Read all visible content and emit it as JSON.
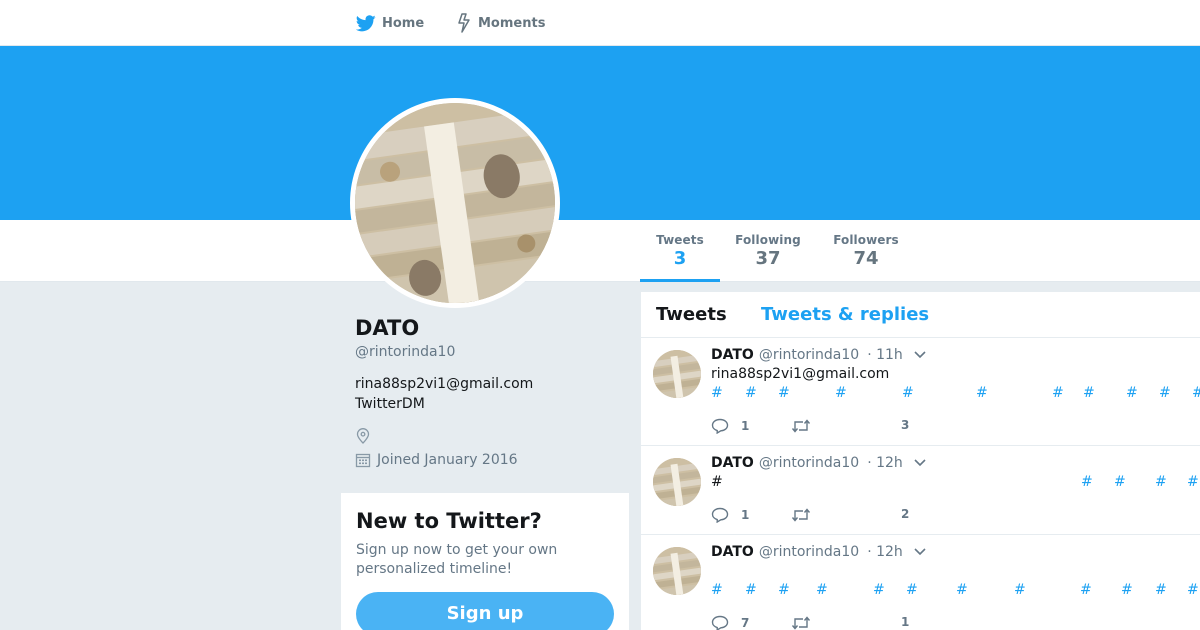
{
  "nav": {
    "home": "Home",
    "moments": "Moments"
  },
  "colors": {
    "brand": "#1da1f2",
    "banner": "#1da1f2",
    "background": "#e6ecf0",
    "signup_button": "#4ab3f4"
  },
  "stats": {
    "tweets_label": "Tweets",
    "tweets_value": "3",
    "following_label": "Following",
    "following_value": "37",
    "followers_label": "Followers",
    "followers_value": "74"
  },
  "profile": {
    "name": "DATO",
    "handle": "@rintorinda10",
    "bio_line1": "rina88sp2vi1@gmail.com",
    "bio_line2": "TwitterDM",
    "joined": "Joined January 2016"
  },
  "signup": {
    "title": "New to Twitter?",
    "text": "Sign up now to get your own personalized timeline!",
    "button": "Sign up"
  },
  "timeline": {
    "tab_tweets": "Tweets",
    "tab_replies": "Tweets & replies",
    "tweets": [
      {
        "name": "DATO",
        "handle": "@rintorinda10",
        "time": "· 11h",
        "text": "rina88sp2vi1@gmail.com",
        "hashtags": [
          "#",
          "#",
          "#",
          "#",
          "#",
          "#",
          "#",
          "#",
          "#",
          "#",
          "#"
        ],
        "replies": "1",
        "retweets": "",
        "likes": "3"
      },
      {
        "name": "DATO",
        "handle": "@rintorinda10",
        "time": "· 12h",
        "text": "#",
        "hashtags": [
          "#",
          "#",
          "#",
          "#"
        ],
        "replies": "1",
        "retweets": "",
        "likes": "2"
      },
      {
        "name": "DATO",
        "handle": "@rintorinda10",
        "time": "· 12h",
        "text": "",
        "hashtags": [
          "#",
          "#",
          "#",
          "#",
          "#",
          "#",
          "#",
          "#",
          "#",
          "#",
          "#",
          "#"
        ],
        "replies": "7",
        "retweets": "",
        "likes": "1"
      }
    ]
  },
  "icons": [
    "bird-icon",
    "bolt-icon",
    "location-icon",
    "calendar-icon",
    "caret-down-icon",
    "reply-icon",
    "retweet-icon",
    "heart-icon"
  ]
}
